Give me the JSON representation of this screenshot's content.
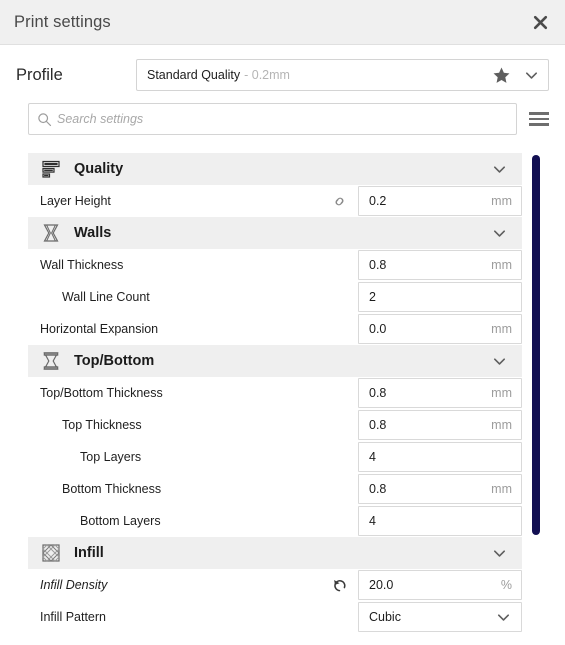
{
  "window": {
    "title": "Print settings",
    "close_icon": "close-icon"
  },
  "profile": {
    "label": "Profile",
    "selected_name": "Standard Quality",
    "selected_detail": "- 0.2mm",
    "star_icon": "star-icon",
    "chevron_icon": "chevron-down-icon"
  },
  "search": {
    "value": "",
    "placeholder": "Search settings",
    "search_icon": "search-icon",
    "menu_icon": "hamburger-menu-icon"
  },
  "colors": {
    "scrollbar": "#120f52",
    "section_header_bg": "#efefef",
    "titlebar_bg": "#f0f0f0"
  },
  "sections": [
    {
      "id": "quality",
      "title": "Quality",
      "icon": "quality-layers-icon",
      "chevron": "chevron-down-icon",
      "rows": [
        {
          "label": "Layer Height",
          "indent": 0,
          "italic": false,
          "row_icon": "link-icon",
          "type": "value",
          "value": "0.2",
          "unit": "mm"
        }
      ]
    },
    {
      "id": "walls",
      "title": "Walls",
      "icon": "walls-outline-icon",
      "chevron": "chevron-down-icon",
      "rows": [
        {
          "label": "Wall Thickness",
          "indent": 0,
          "italic": false,
          "row_icon": null,
          "type": "value",
          "value": "0.8",
          "unit": "mm"
        },
        {
          "label": "Wall Line Count",
          "indent": 1,
          "italic": false,
          "row_icon": null,
          "type": "value",
          "value": "2",
          "unit": ""
        },
        {
          "label": "Horizontal Expansion",
          "indent": 0,
          "italic": false,
          "row_icon": null,
          "type": "value",
          "value": "0.0",
          "unit": "mm"
        }
      ]
    },
    {
      "id": "top-bottom",
      "title": "Top/Bottom",
      "icon": "top-bottom-icon",
      "chevron": "chevron-down-icon",
      "rows": [
        {
          "label": "Top/Bottom Thickness",
          "indent": 0,
          "italic": false,
          "row_icon": null,
          "type": "value",
          "value": "0.8",
          "unit": "mm"
        },
        {
          "label": "Top Thickness",
          "indent": 1,
          "italic": false,
          "row_icon": null,
          "type": "value",
          "value": "0.8",
          "unit": "mm"
        },
        {
          "label": "Top Layers",
          "indent": 2,
          "italic": false,
          "row_icon": null,
          "type": "value",
          "value": "4",
          "unit": ""
        },
        {
          "label": "Bottom Thickness",
          "indent": 1,
          "italic": false,
          "row_icon": null,
          "type": "value",
          "value": "0.8",
          "unit": "mm"
        },
        {
          "label": "Bottom Layers",
          "indent": 2,
          "italic": false,
          "row_icon": null,
          "type": "value",
          "value": "4",
          "unit": ""
        }
      ]
    },
    {
      "id": "infill",
      "title": "Infill",
      "icon": "infill-lattice-icon",
      "chevron": "chevron-down-icon",
      "rows": [
        {
          "label": "Infill Density",
          "indent": 0,
          "italic": true,
          "row_icon": "revert-icon",
          "type": "value",
          "value": "20.0",
          "unit": "%"
        },
        {
          "label": "Infill Pattern",
          "indent": 0,
          "italic": false,
          "row_icon": null,
          "type": "dropdown",
          "value": "Cubic",
          "unit": ""
        }
      ]
    }
  ]
}
